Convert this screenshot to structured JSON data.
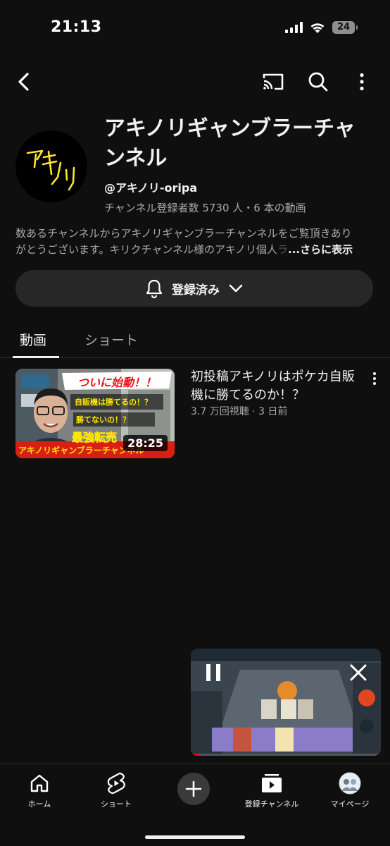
{
  "status_bar": {
    "time": "21:13",
    "battery": "24"
  },
  "channel": {
    "name": "アキノリギャンブラーチャンネル",
    "avatar_text": "アキノリ",
    "handle": "@アキノリ-oripa",
    "meta": "チャンネル登録者数 5730 人・6 本の動画",
    "description_line1": "数あるチャンネルからアキノリギャンブラーチャンネルをご覧頂きあり",
    "description_line2": "がとうございます。キリクチャンネル様のアキノリ個人",
    "description_fade": "ラ",
    "more_label": "...さらに表示"
  },
  "subscribe": {
    "label": "登録済み"
  },
  "tabs": {
    "videos": "動画",
    "shorts": "ショート"
  },
  "video": {
    "title": "初投稿アキノリはポケカ自販機に勝てるのか！？",
    "meta": "3.7 万回視聴 · 3 日前",
    "duration": "28:25",
    "thumb_banner": "ついに始動！！",
    "thumb_line1": "自販機は勝てるの！？",
    "thumb_line2": "勝てないの！？",
    "thumb_line3": "最強転売",
    "thumb_footer": "アキノリギャンブラーチャンネル"
  },
  "mini_player": {
    "progress": 0.04
  },
  "bottom_nav": {
    "home": "ホーム",
    "shorts": "ショート",
    "subscriptions": "登録チャンネル",
    "mypage": "マイページ"
  },
  "colors": {
    "background": "#0f0f0f",
    "surface": "#272727",
    "text": "#f1f1f1",
    "secondary": "#aaaaaa",
    "accent": "#ff0000"
  }
}
